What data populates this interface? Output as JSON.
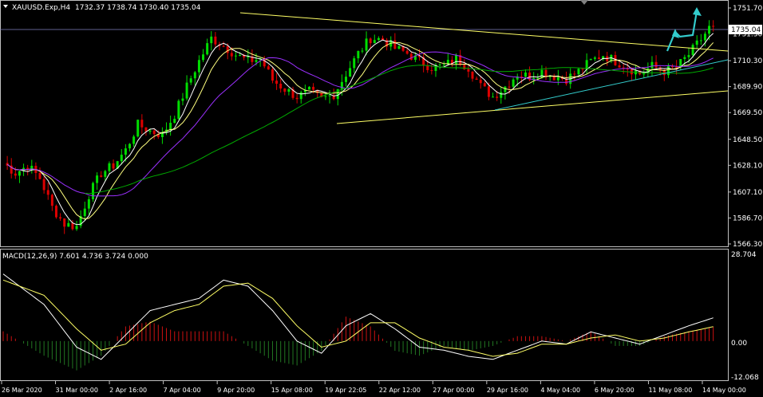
{
  "header": {
    "symbol": "XAUUSD.Exp,H4",
    "ohlc": "1732.37 1738.74 1730.40 1735.04"
  },
  "price_axis": {
    "ticks": [
      "1751.70",
      "1731.30",
      "1710.30",
      "1689.90",
      "1669.50",
      "1648.50",
      "1628.10",
      "1607.10",
      "1586.70",
      "1566.30"
    ],
    "current_price": "1735.04"
  },
  "macd": {
    "title": "MACD(12,26,9) 7.601 4.736 3.724 0.000",
    "ticks": [
      "28.704",
      "0.00",
      "-12.068"
    ]
  },
  "time_axis": {
    "labels": [
      "26 Mar 2020",
      "31 Mar 00:00",
      "2 Apr 16:00",
      "7 Apr 04:00",
      "9 Apr 20:00",
      "15 Apr 08:00",
      "19 Apr 22:05",
      "22 Apr 12:00",
      "27 Apr 00:00",
      "29 Apr 16:00",
      "4 May 04:00",
      "6 May 20:00",
      "11 May 08:00",
      "14 May 00:00"
    ]
  },
  "colors": {
    "background": "#000000",
    "bull_candle": "#00dd00",
    "bear_candle": "#dd0000",
    "ma_fast": "#ffffff",
    "ma_mid": "#ffff80",
    "ma_slow": "#9b30ff",
    "ma_long": "#00aa00",
    "trendline": "#ffff66",
    "support_line": "#33cccc",
    "arrow": "#33cccc",
    "macd_hist_pos": "#cc1111",
    "macd_hist_neg": "#227722",
    "macd_line": "#ffffff",
    "signal_line": "#ffff66",
    "axis_text": "#ffffff"
  },
  "chart_data": {
    "type": "candlestick",
    "price_range": [
      1566.3,
      1751.7
    ],
    "close_path": [
      [
        0,
        1630
      ],
      [
        3,
        1622
      ],
      [
        6,
        1628
      ],
      [
        9,
        1618
      ],
      [
        12,
        1595
      ],
      [
        15,
        1582
      ],
      [
        18,
        1580
      ],
      [
        21,
        1605
      ],
      [
        24,
        1622
      ],
      [
        27,
        1628
      ],
      [
        30,
        1640
      ],
      [
        33,
        1660
      ],
      [
        36,
        1655
      ],
      [
        39,
        1652
      ],
      [
        42,
        1668
      ],
      [
        45,
        1690
      ],
      [
        48,
        1710
      ],
      [
        51,
        1728
      ],
      [
        54,
        1722
      ],
      [
        57,
        1715
      ],
      [
        60,
        1710
      ],
      [
        63,
        1712
      ],
      [
        66,
        1695
      ],
      [
        69,
        1688
      ],
      [
        72,
        1682
      ],
      [
        75,
        1686
      ],
      [
        78,
        1680
      ],
      [
        81,
        1684
      ],
      [
        84,
        1700
      ],
      [
        87,
        1716
      ],
      [
        90,
        1728
      ],
      [
        93,
        1727
      ],
      [
        96,
        1720
      ],
      [
        99,
        1716
      ],
      [
        102,
        1710
      ],
      [
        105,
        1705
      ],
      [
        108,
        1706
      ],
      [
        111,
        1712
      ],
      [
        114,
        1705
      ],
      [
        117,
        1690
      ],
      [
        120,
        1682
      ],
      [
        123,
        1690
      ],
      [
        126,
        1700
      ],
      [
        129,
        1698
      ],
      [
        132,
        1702
      ],
      [
        135,
        1698
      ],
      [
        138,
        1696
      ],
      [
        141,
        1702
      ],
      [
        144,
        1710
      ],
      [
        147,
        1715
      ],
      [
        150,
        1710
      ],
      [
        153,
        1705
      ],
      [
        156,
        1700
      ],
      [
        159,
        1706
      ],
      [
        162,
        1702
      ],
      [
        165,
        1705
      ],
      [
        168,
        1715
      ],
      [
        171,
        1727
      ],
      [
        173,
        1736
      ],
      [
        174,
        1735
      ]
    ],
    "macd_values": [
      [
        0,
        22
      ],
      [
        10,
        12
      ],
      [
        18,
        -2
      ],
      [
        24,
        -6
      ],
      [
        30,
        2
      ],
      [
        36,
        10
      ],
      [
        42,
        12
      ],
      [
        48,
        14
      ],
      [
        54,
        20
      ],
      [
        60,
        18
      ],
      [
        66,
        10
      ],
      [
        72,
        0
      ],
      [
        78,
        -4
      ],
      [
        84,
        5
      ],
      [
        90,
        9
      ],
      [
        96,
        4
      ],
      [
        102,
        -2
      ],
      [
        108,
        -3
      ],
      [
        114,
        -5
      ],
      [
        120,
        -6
      ],
      [
        126,
        -3
      ],
      [
        132,
        0
      ],
      [
        138,
        -1
      ],
      [
        144,
        3
      ],
      [
        150,
        1
      ],
      [
        156,
        -1
      ],
      [
        162,
        2
      ],
      [
        168,
        5
      ],
      [
        174,
        7.6
      ]
    ],
    "signal_values": [
      [
        0,
        20
      ],
      [
        10,
        15
      ],
      [
        18,
        4
      ],
      [
        24,
        -3
      ],
      [
        30,
        -1
      ],
      [
        36,
        6
      ],
      [
        42,
        10
      ],
      [
        48,
        12
      ],
      [
        54,
        18
      ],
      [
        60,
        19
      ],
      [
        66,
        14
      ],
      [
        72,
        5
      ],
      [
        78,
        -2
      ],
      [
        84,
        0
      ],
      [
        90,
        6
      ],
      [
        96,
        6
      ],
      [
        102,
        1
      ],
      [
        108,
        -2
      ],
      [
        114,
        -3
      ],
      [
        120,
        -5
      ],
      [
        126,
        -4
      ],
      [
        132,
        -1
      ],
      [
        138,
        -1
      ],
      [
        144,
        1
      ],
      [
        150,
        2
      ],
      [
        156,
        0
      ],
      [
        162,
        1
      ],
      [
        168,
        3
      ],
      [
        174,
        4.7
      ]
    ],
    "macd_range": [
      -12.068,
      28.704
    ],
    "macd_params": "12,26,9",
    "macd_readout": {
      "macd": 7.601,
      "signal": 4.736,
      "histogram": 3.724
    }
  }
}
